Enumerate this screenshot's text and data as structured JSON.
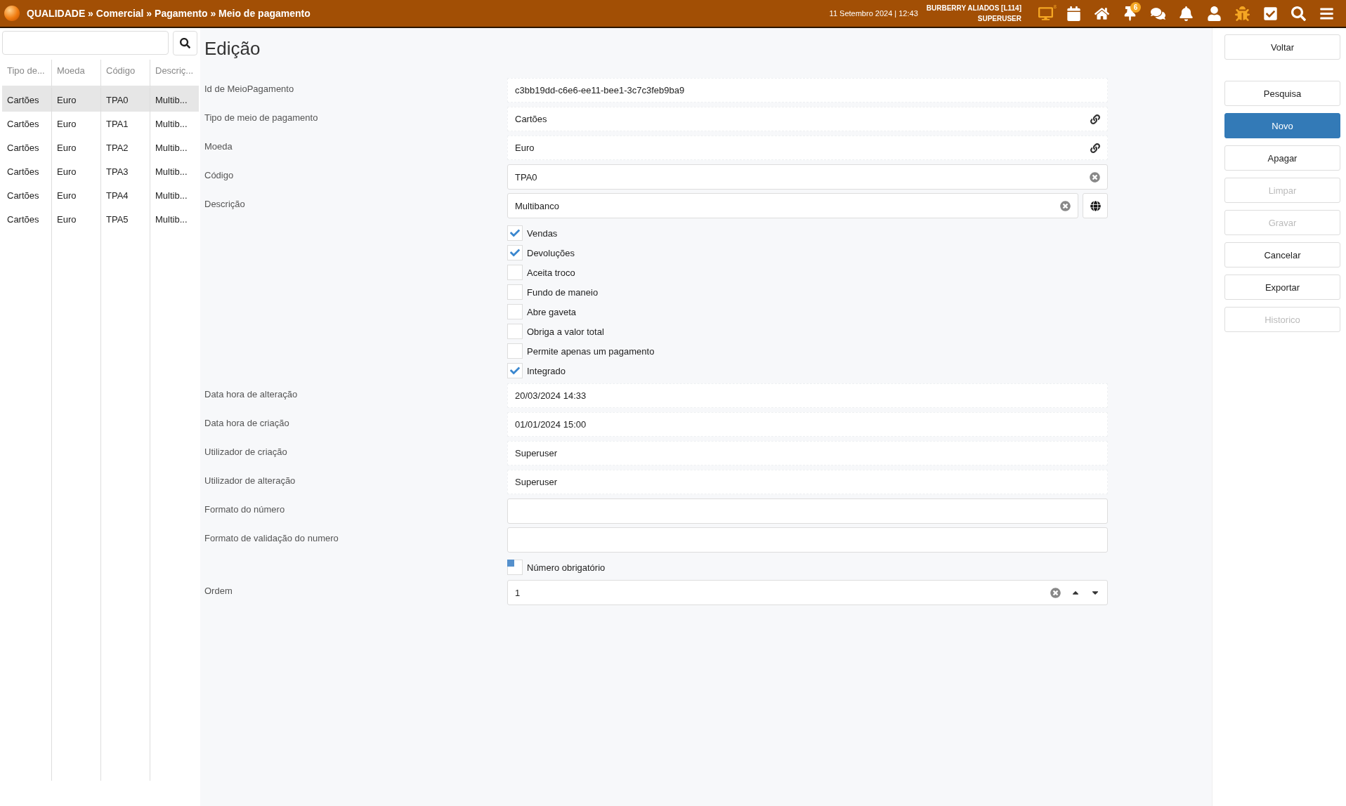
{
  "topbar": {
    "breadcrumb": "QUALIDADE » Comercial » Pagamento » Meio de pagamento",
    "datetime": "11 Setembro 2024 | 12:43",
    "company": "BURBERRY ALIADOS [L114]",
    "user": "SUPERUSER",
    "icons": [
      {
        "kind": "monitor",
        "color": "#f5a623",
        "sup": "8"
      },
      {
        "kind": "calendar",
        "color": "#ffffff"
      },
      {
        "kind": "home",
        "color": "#ffffff"
      },
      {
        "kind": "pin",
        "color": "#ffffff",
        "badge": "6"
      },
      {
        "kind": "chat",
        "color": "#ffffff"
      },
      {
        "kind": "bell",
        "color": "#ffffff"
      },
      {
        "kind": "user",
        "color": "#ffffff"
      },
      {
        "kind": "bug",
        "color": "#f5a623"
      },
      {
        "kind": "tasks",
        "color": "#ffffff"
      },
      {
        "kind": "search",
        "color": "#ffffff"
      },
      {
        "kind": "menu",
        "color": "#ffffff"
      }
    ]
  },
  "list": {
    "columns": [
      "Tipo de...",
      "Moeda",
      "Código",
      "Descriç..."
    ],
    "rows": [
      {
        "selected": true,
        "cells": [
          "Cartões",
          "Euro",
          "TPA0",
          "Multib..."
        ]
      },
      {
        "selected": false,
        "cells": [
          "Cartões",
          "Euro",
          "TPA1",
          "Multib..."
        ]
      },
      {
        "selected": false,
        "cells": [
          "Cartões",
          "Euro",
          "TPA2",
          "Multib..."
        ]
      },
      {
        "selected": false,
        "cells": [
          "Cartões",
          "Euro",
          "TPA3",
          "Multib..."
        ]
      },
      {
        "selected": false,
        "cells": [
          "Cartões",
          "Euro",
          "TPA4",
          "Multib..."
        ]
      },
      {
        "selected": false,
        "cells": [
          "Cartões",
          "Euro",
          "TPA5",
          "Multib..."
        ]
      }
    ]
  },
  "form": {
    "title": "Edição",
    "fields": [
      {
        "kind": "readonly",
        "label": "Id de MeioPagamento",
        "value": "c3bb19dd-c6e6-ee11-bee1-3c7c3feb9ba9"
      },
      {
        "kind": "lookup",
        "label": "Tipo de meio de pagamento",
        "value": "Cartões"
      },
      {
        "kind": "lookup",
        "label": "Moeda",
        "value": "Euro"
      },
      {
        "kind": "text",
        "label": "Código",
        "value": "TPA0"
      },
      {
        "kind": "translatable",
        "label": "Descrição",
        "value": "Multibanco"
      },
      {
        "kind": "checks",
        "options": [
          {
            "label": "Vendas",
            "checked": true
          },
          {
            "label": "Devoluções",
            "checked": true
          },
          {
            "label": "Aceita troco",
            "checked": false
          },
          {
            "label": "Fundo de maneio",
            "checked": false
          },
          {
            "label": "Abre gaveta",
            "checked": false
          },
          {
            "label": "Obriga a valor total",
            "checked": false
          },
          {
            "label": "Permite apenas um pagamento",
            "checked": false
          },
          {
            "label": "Integrado",
            "checked": true
          }
        ]
      },
      {
        "kind": "readonly",
        "label": "Data hora de alteração",
        "value": "20/03/2024 14:33"
      },
      {
        "kind": "readonly",
        "label": "Data hora de criação",
        "value": "01/01/2024 15:00"
      },
      {
        "kind": "readonly",
        "label": "Utilizador de criação",
        "value": "Superuser"
      },
      {
        "kind": "readonly",
        "label": "Utilizador de alteração",
        "value": "Superuser"
      },
      {
        "kind": "empty",
        "label": "Formato do número"
      },
      {
        "kind": "empty",
        "label": "Formato de validação do numero"
      },
      {
        "kind": "checks",
        "options": [
          {
            "label": "Número obrigatório",
            "indeterminate": true
          }
        ]
      },
      {
        "kind": "number",
        "label": "Ordem",
        "value": "1"
      }
    ]
  },
  "actions": [
    {
      "label": "Voltar",
      "primary": false,
      "disabled": false
    },
    {
      "label": "Pesquisa",
      "primary": false,
      "disabled": false
    },
    {
      "label": "Novo",
      "primary": true,
      "disabled": false
    },
    {
      "label": "Apagar",
      "primary": false,
      "disabled": false
    },
    {
      "label": "Limpar",
      "primary": false,
      "disabled": true
    },
    {
      "label": "Gravar",
      "primary": false,
      "disabled": true
    },
    {
      "label": "Cancelar",
      "primary": false,
      "disabled": false
    },
    {
      "label": "Exportar",
      "primary": false,
      "disabled": false
    },
    {
      "label": "Historico",
      "primary": false,
      "disabled": true
    }
  ]
}
